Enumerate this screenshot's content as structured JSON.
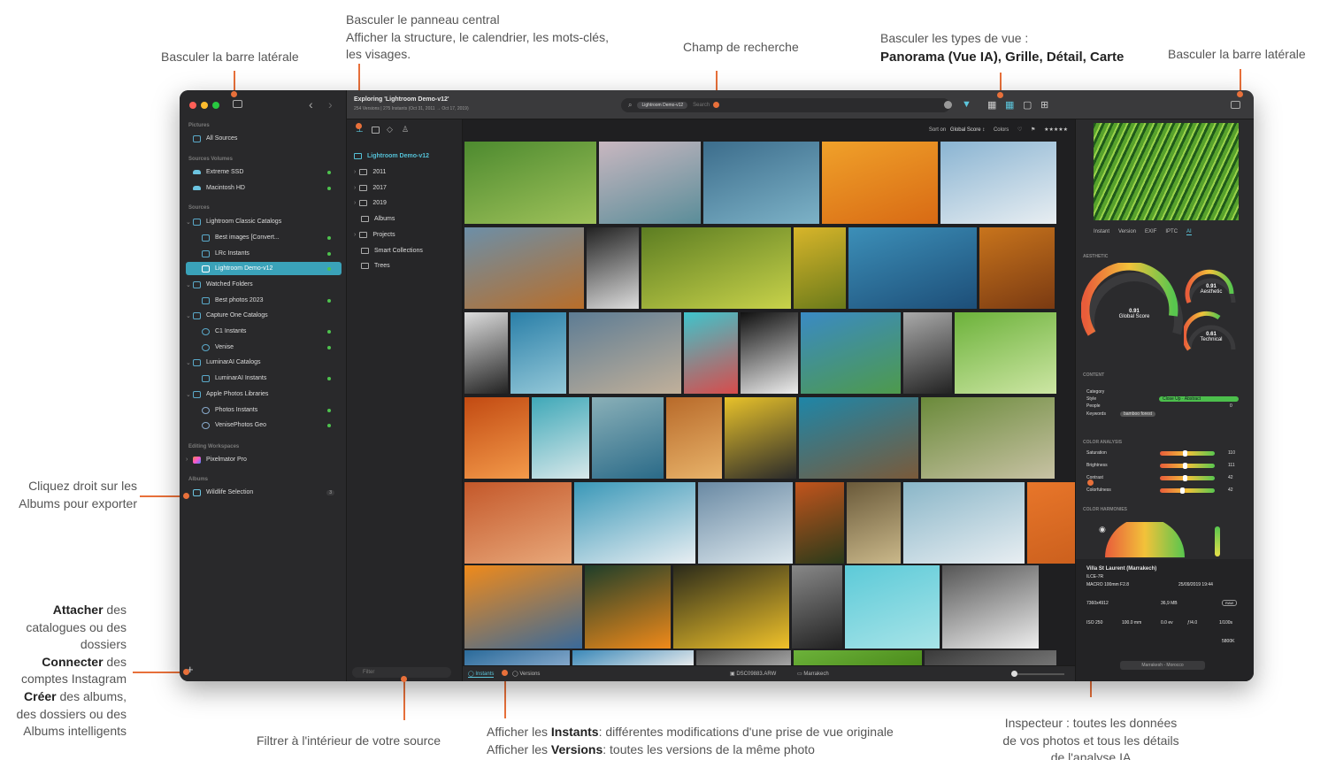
{
  "annotations": {
    "toggle_sidebar_left": "Basculer la barre latérale",
    "toggle_center_panel_line1": "Basculer le panneau central",
    "toggle_center_panel_line2": "Afficher la structure, le calendrier, les mots-clés,",
    "toggle_center_panel_line3": "les visages.",
    "search_field": "Champ de recherche",
    "view_types_line1": "Basculer les types de vue :",
    "view_types_line2": "Panorama (Vue IA), Grille, Détail, Carte",
    "toggle_sidebar_right": "Basculer la barre latérale",
    "right_click_albums_line1": "Cliquez droit sur les",
    "right_click_albums_line2": "Albums pour exporter",
    "attach_bold": "Attacher",
    "attach_rest1": " des",
    "attach_line2": "catalogues ou des",
    "attach_line3": "dossiers",
    "connect_bold": "Connecter",
    "connect_rest": " des",
    "connect_line2": "comptes Instagram",
    "create_bold": "Créer",
    "create_rest": " des albums,",
    "create_line2": "des dossiers ou des",
    "create_line3": "Albums intelligents",
    "filter_source": "Filtrer à l'intérieur de votre source",
    "instants_prefix": "Afficher les ",
    "instants_bold": "Instants",
    "instants_rest": ": différentes modifications d'une prise de vue originale",
    "versions_prefix": "Afficher les ",
    "versions_bold": "Versions",
    "versions_rest": ": toutes les versions de la même photo",
    "inspector_line1": "Inspecteur : toutes les données",
    "inspector_line2": "de vos photos et tous les détails",
    "inspector_line3": "de l'analyse IA"
  },
  "window": {
    "title": "Exploring 'Lightroom Demo-v12'",
    "subtitle": "254 Versions | 275 Instants (Oct 31, 2011 → Oct 17, 2019)",
    "search_chip": "Lightroom Demo-v12",
    "search_placeholder": "Search"
  },
  "sidebar": {
    "sections": [
      {
        "label": "Pictures",
        "items": [
          {
            "label": "All Sources",
            "icon": "library-icon"
          }
        ]
      },
      {
        "label": "Sources Volumes",
        "items": [
          {
            "label": "Extreme SSD",
            "icon": "disk-icon",
            "status": true
          },
          {
            "label": "Macintosh HD",
            "icon": "disk-icon",
            "status": true
          }
        ]
      },
      {
        "label": "Sources",
        "items": []
      }
    ],
    "items": [
      "Lightroom Classic Catalogs",
      "Best images [Convert...",
      "LRc Instants",
      "Lightroom Demo-v12",
      "Watched Folders",
      "Best photos 2023",
      "Capture One Catalogs",
      "C1 Instants",
      "Venise",
      "LuminarAI Catalogs",
      "LuminarAI Instants",
      "Apple Photos Libraries",
      "Photos Instants",
      "VenisePhotos Geo"
    ],
    "editing_section": "Editing Workspaces",
    "editing_item": "Pixelmator Pro",
    "albums_section": "Albums",
    "album_item": "Wildlife Selection",
    "album_count": "3"
  },
  "midpanel": {
    "root": "Lightroom Demo-v12",
    "items": [
      "2011",
      "2017",
      "2019",
      "Albums",
      "Projects",
      "Smart Collections",
      "Trees"
    ],
    "filter_placeholder": "Filter"
  },
  "sortbar": {
    "sort_label": "Sort on",
    "sort_value": "Global Score ↕",
    "colors_label": "Colors",
    "stars": "★★★★★"
  },
  "bottombar": {
    "instants_tab": "Instants",
    "versions_tab": "Versions",
    "filename": "DSC09883.ARW",
    "album": "Marrakech"
  },
  "inspector": {
    "tabs": [
      "Instant",
      "Version",
      "EXIF",
      "IPTC",
      "AI"
    ],
    "active_tab": "AI",
    "aesthetic_section": "AESTHETIC",
    "global_score": "0.91",
    "global_score_label": "Global Score",
    "aesthetic_value": "0.91",
    "aesthetic_label": "Aesthetic",
    "technical_value": "0.61",
    "technical_label": "Technical",
    "content_section": "CONTENT",
    "content_rows": [
      {
        "key": "Category",
        "value": ""
      },
      {
        "key": "Style",
        "value": "Close Up · Abstract"
      },
      {
        "key": "People",
        "value": "0"
      },
      {
        "key": "Keywords",
        "value": "bamboo forest"
      }
    ],
    "color_section": "COLOR ANALYSIS",
    "color_rows": [
      {
        "key": "Saturation",
        "value": "110",
        "level": 0.45
      },
      {
        "key": "Brightness",
        "value": "111",
        "level": 0.45
      },
      {
        "key": "Contrast",
        "value": "42",
        "level": 0.45
      },
      {
        "key": "Colorfulness",
        "value": "42",
        "level": 0.4
      }
    ],
    "harmonies_section": "COLOR HARMONIES",
    "location": "Villa St Laurent (Marrakech)",
    "camera": "ILCE-7R",
    "lens": "MACRO 100mm F2.8",
    "date": "25/09/2019 19:44",
    "dimensions": "7360x4912",
    "size": "36,9 MB",
    "format": "RAW",
    "iso": "ISO 250",
    "focal": "100.0 mm",
    "ev": "0.0 ev",
    "aperture": "ƒ/4.0",
    "shutter": "1/100s",
    "wb": "5800K",
    "place_tag": "Marrakesh - Morocco"
  },
  "colors": {
    "accent": "#e8703a",
    "selection": "#3aa2b9",
    "status_green": "#4ec24e"
  }
}
